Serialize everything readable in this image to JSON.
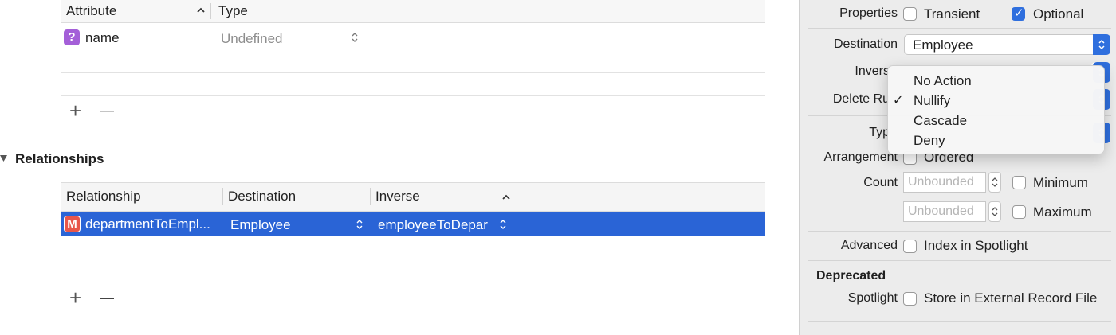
{
  "attributes": {
    "header_attribute": "Attribute",
    "header_type": "Type",
    "rows": [
      {
        "badge": "?",
        "name": "name",
        "type": "Undefined"
      }
    ],
    "add_label": "+",
    "remove_label": "—"
  },
  "relationships": {
    "section_title": "Relationships",
    "header_relationship": "Relationship",
    "header_destination": "Destination",
    "header_inverse": "Inverse",
    "rows": [
      {
        "badge": "M",
        "name": "departmentToEmpl...",
        "destination": "Employee",
        "inverse": "employeeToDepar"
      }
    ],
    "add_label": "+",
    "remove_label": "—"
  },
  "inspector": {
    "properties_label": "Properties",
    "transient_label": "Transient",
    "optional_label": "Optional",
    "destination_label": "Destination",
    "destination_value": "Employee",
    "inverse_label": "Invers",
    "delete_rule_label": "Delete Ru",
    "type_label": "Typ",
    "arrangement_label": "Arrangement",
    "ordered_label": "Ordered",
    "count_label": "Count",
    "min_placeholder": "Unbounded",
    "max_placeholder": "Unbounded",
    "minimum_label": "Minimum",
    "maximum_label": "Maximum",
    "advanced_label": "Advanced",
    "index_spotlight_label": "Index in Spotlight",
    "deprecated_header": "Deprecated",
    "spotlight_label": "Spotlight",
    "store_external_label": "Store in External Record File"
  },
  "delete_rule_menu": {
    "items": [
      "No Action",
      "Nullify",
      "Cascade",
      "Deny"
    ],
    "checked": "Nullify",
    "check_mark": "✓"
  },
  "colors": {
    "selection_blue": "#2a64d6",
    "accent_blue": "#2f6fde",
    "attribute_badge": "#a45fd8",
    "relationship_badge": "#e8564a"
  }
}
